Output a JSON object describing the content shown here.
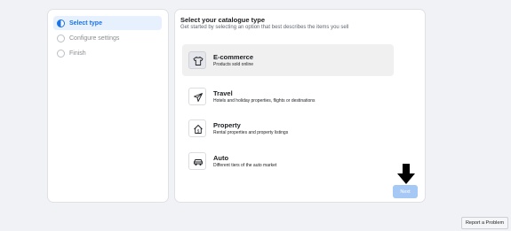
{
  "steps": [
    {
      "label": "Select type",
      "state": "active"
    },
    {
      "label": "Configure settings",
      "state": "inactive"
    },
    {
      "label": "Finish",
      "state": "inactive"
    }
  ],
  "main": {
    "title": "Select your catalogue type",
    "subtitle": "Get started by selecting an option that best describes the items you sell",
    "options": [
      {
        "title": "E-commerce",
        "description": "Products sold online",
        "icon": "tshirt-icon",
        "selected": true
      },
      {
        "title": "Travel",
        "description": "Hotels and holiday properties, flights or destinations",
        "icon": "airplane-icon",
        "selected": false
      },
      {
        "title": "Property",
        "description": "Rental properties and property listings",
        "icon": "house-icon",
        "selected": false
      },
      {
        "title": "Auto",
        "description": "Different tiers of the auto market",
        "icon": "car-icon",
        "selected": false
      }
    ],
    "next_label": "Next"
  },
  "footer": {
    "report_label": "Report a Problem"
  },
  "colors": {
    "accent": "#1b74e4",
    "next_disabled": "#a6c8f5",
    "background": "#f0f2f5"
  }
}
